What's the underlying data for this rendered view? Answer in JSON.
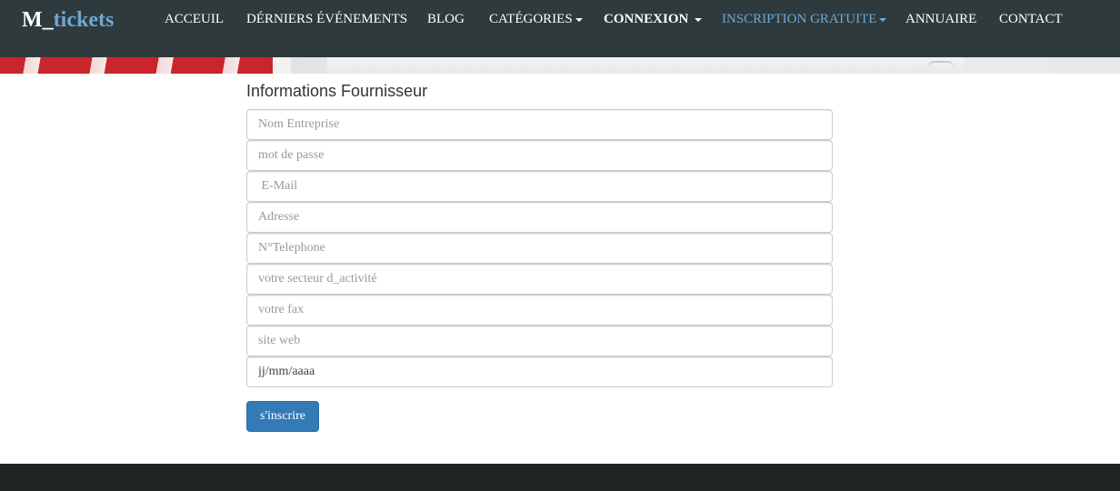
{
  "brand": {
    "part1": "M_",
    "part2": "tickets"
  },
  "nav": {
    "items": [
      {
        "label": "ACCEUIL"
      },
      {
        "label": "DÉRNIERS ÉVÉNEMENTS"
      },
      {
        "label": "BLOG"
      },
      {
        "label": "CATÉGORIES"
      },
      {
        "label": "CONNEXION"
      },
      {
        "label": "INSCRIPTION GRATUITE"
      },
      {
        "label": "ANNUAIRE"
      },
      {
        "label": "CONTACT"
      }
    ]
  },
  "form": {
    "title": "Informations Fournisseur",
    "fields": {
      "company": {
        "placeholder": "Nom Entreprise"
      },
      "password": {
        "placeholder": "mot de passe"
      },
      "email": {
        "placeholder": " E-Mail"
      },
      "address": {
        "placeholder": "Adresse"
      },
      "phone": {
        "placeholder": "N°Telephone"
      },
      "sector": {
        "placeholder": "votre secteur d_activité"
      },
      "fax": {
        "placeholder": "votre fax"
      },
      "website": {
        "placeholder": "site web"
      },
      "date": {
        "value": "jj/mm/aaaa"
      }
    },
    "submit_label": "s'inscrire"
  },
  "colors": {
    "navbar_bg": "#2f3a3d",
    "brand_accent": "#6ea8d3",
    "button_primary": "#337ab7",
    "footer_bg": "#202425"
  }
}
